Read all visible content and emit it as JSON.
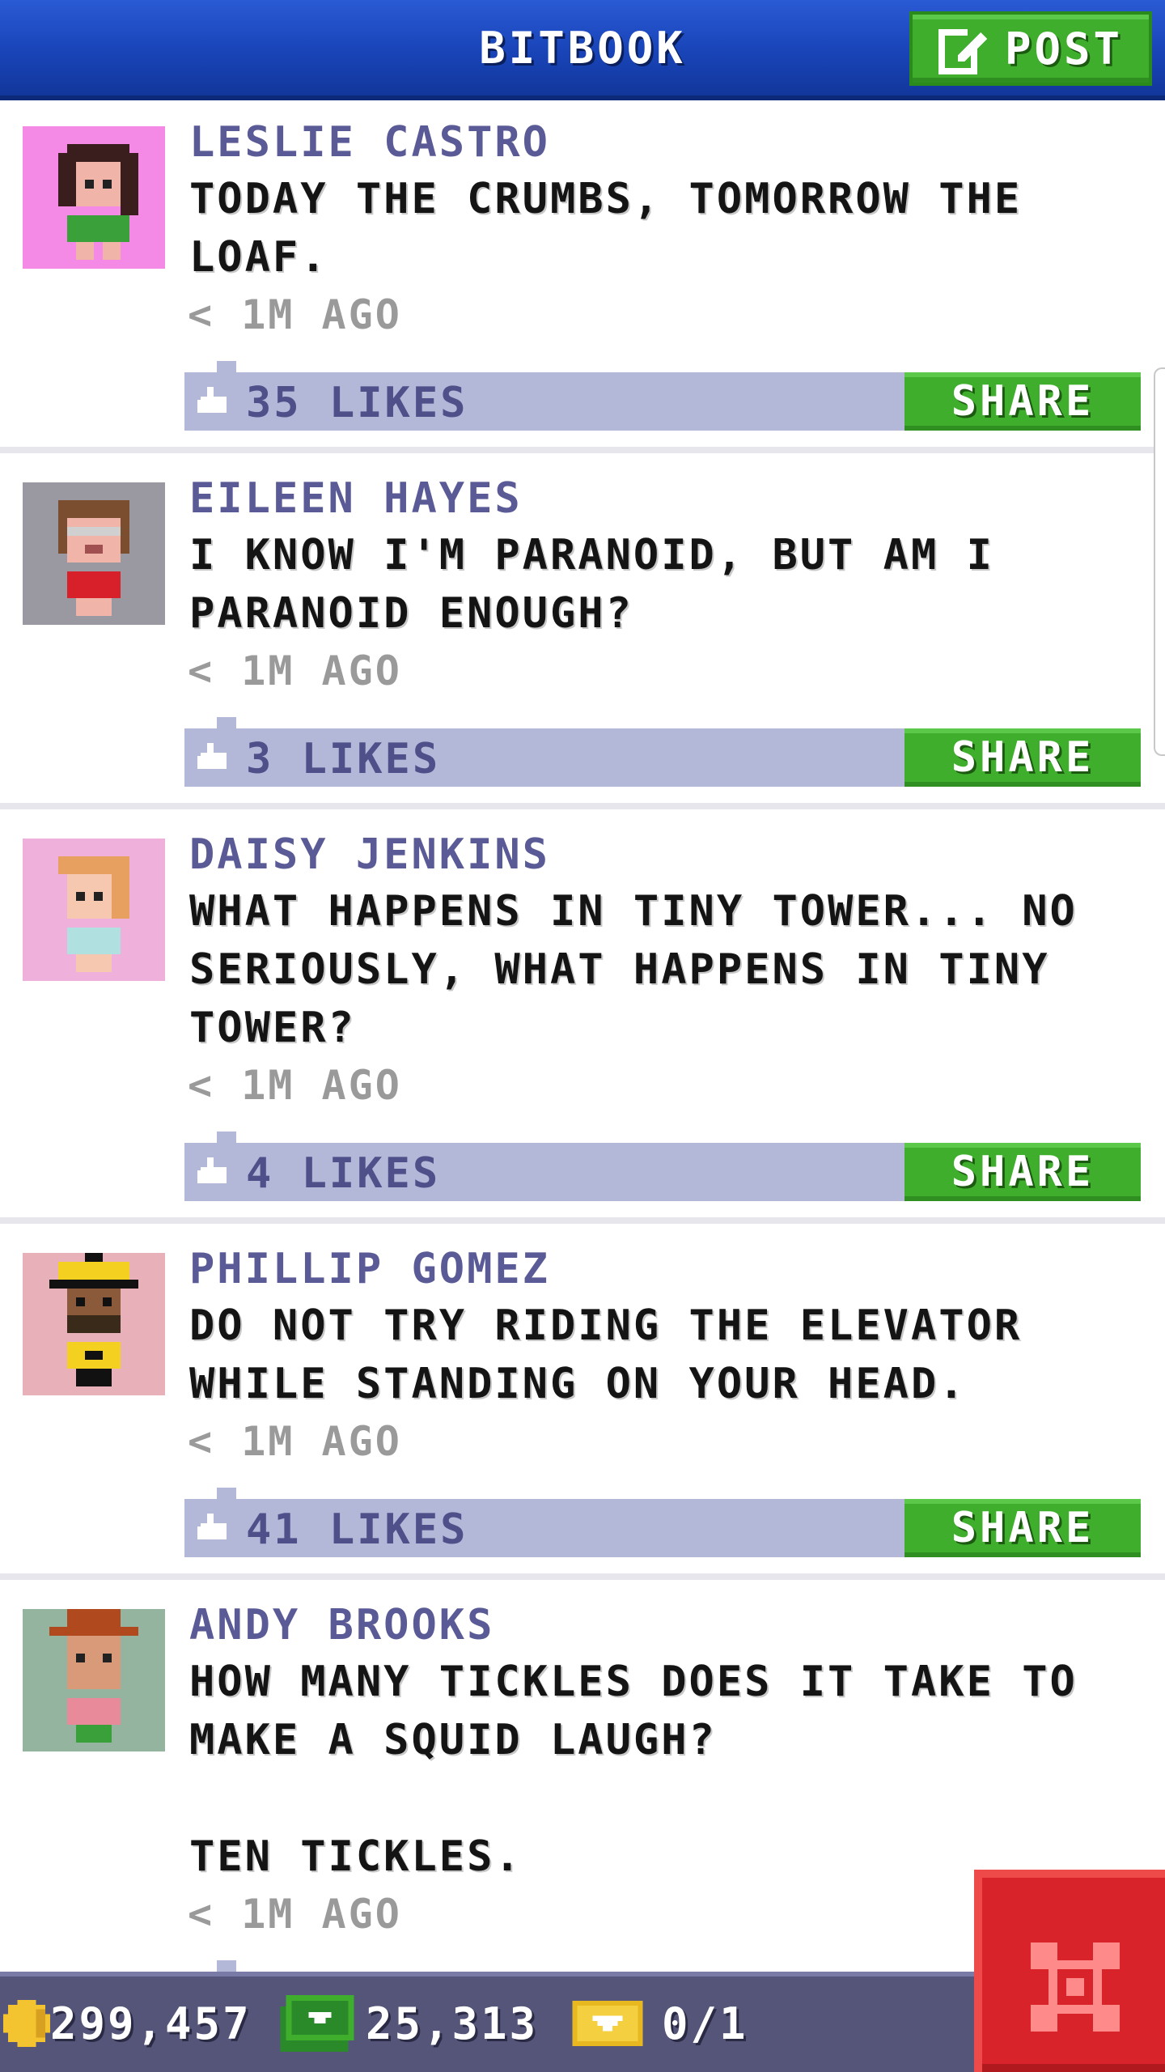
{
  "header": {
    "title": "BITBOOK",
    "post_button_label": "POST"
  },
  "posts": [
    {
      "author": "LESLIE CASTRO",
      "message": "TODAY THE CRUMBS, TOMORROW THE\nLOAF.",
      "timestamp": "< 1M AGO",
      "likes": "35 LIKES",
      "share_label": "SHARE",
      "avatar_bg": "#f48ae6"
    },
    {
      "author": "EILEEN HAYES",
      "message": "I KNOW I'M PARANOID, BUT AM I\nPARANOID ENOUGH?",
      "timestamp": "< 1M AGO",
      "likes": "3 LIKES",
      "share_label": "SHARE",
      "avatar_bg": "#9a98a0"
    },
    {
      "author": "DAISY JENKINS",
      "message": "WHAT HAPPENS IN TINY TOWER... NO\nSERIOUSLY, WHAT HAPPENS IN TINY\nTOWER?",
      "timestamp": "< 1M AGO",
      "likes": "4 LIKES",
      "share_label": "SHARE",
      "avatar_bg": "#f0b0dc"
    },
    {
      "author": "PHILLIP GOMEZ",
      "message": "DO NOT TRY RIDING THE ELEVATOR\nWHILE STANDING ON YOUR HEAD.",
      "timestamp": "< 1M AGO",
      "likes": "41 LIKES",
      "share_label": "SHARE",
      "avatar_bg": "#e8b0b8"
    },
    {
      "author": "ANDY BROOKS",
      "message": "HOW MANY TICKLES DOES IT TAKE TO\nMAKE A SQUID LAUGH?\n\nTEN TICKLES.",
      "timestamp": "< 1M AGO",
      "avatar_bg": "#94b4a0"
    }
  ],
  "footer": {
    "coins": "299,457",
    "bux": "25,313",
    "tickets": "0/1"
  },
  "icons": {
    "post": "edit-icon",
    "like": "thumbs-up-icon",
    "coin": "coin-icon",
    "bux": "bux-icon",
    "ticket": "ticket-icon",
    "close": "close-icon"
  },
  "colors": {
    "header_blue": "#1944b8",
    "button_green": "#3fae2c",
    "like_bar": "#b4b8d8",
    "author_purple": "#5a5a96",
    "footer_bg": "#55557a",
    "close_red": "#d8232a"
  }
}
